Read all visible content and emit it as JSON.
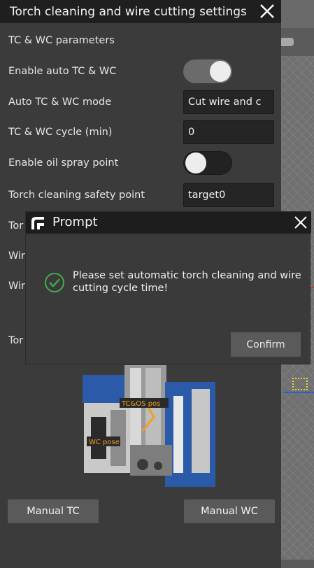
{
  "window": {
    "title": "Torch cleaning and wire cutting settings",
    "close_icon": "close-icon"
  },
  "section": {
    "header": "TC & WC parameters"
  },
  "rows": {
    "enable_auto": {
      "label": "Enable auto TC & WC",
      "state": "on"
    },
    "mode": {
      "label": "Auto TC & WC mode",
      "value": "Cut wire and c"
    },
    "cycle": {
      "label": "TC & WC cycle (min)",
      "value": "0"
    },
    "oil_spray": {
      "label": "Enable oil spray point",
      "state": "off"
    },
    "safety_point": {
      "label": "Torch cleaning safety point",
      "value": "target0"
    },
    "hidden_1": {
      "label": "Tor"
    },
    "hidden_2": {
      "label": "Wir"
    },
    "hidden_3": {
      "label": "Wir"
    },
    "hidden_4": {
      "label": "Tor"
    }
  },
  "image_labels": {
    "tc_os": "TC&OS pos",
    "wc": "WC pose"
  },
  "buttons": {
    "manual_tc": "Manual TC",
    "manual_wc": "Manual WC"
  },
  "dialog": {
    "title": "Prompt",
    "message": "Please set automatic torch cleaning and wire cutting cycle time!",
    "confirm": "Confirm",
    "icons": [
      "app-logo-icon",
      "close-icon",
      "success-check-icon"
    ]
  },
  "colors": {
    "title_bar": "#1f1f1f",
    "panel": "#3b3b3b",
    "accent_check": "#3fae49",
    "device_blue": "#2a5aa8",
    "label_orange": "#f0a020"
  }
}
